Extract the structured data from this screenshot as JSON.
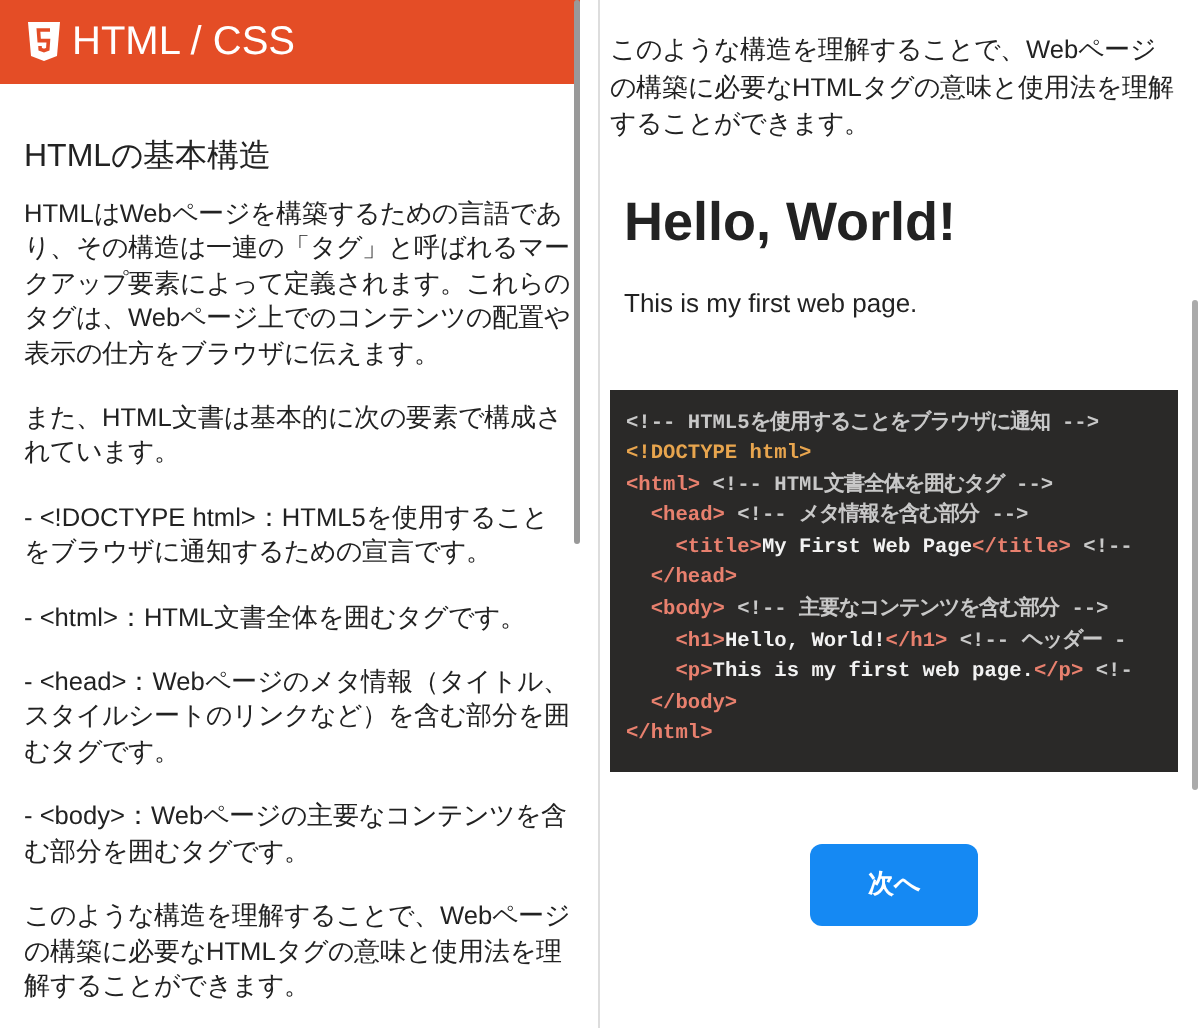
{
  "left": {
    "header": {
      "title": "HTML / CSS"
    },
    "heading": "HTMLの基本構造",
    "paragraphs": [
      "HTMLはWebページを構築するための言語であり、その構造は一連の「タグ」と呼ばれるマークアップ要素によって定義されます。これらのタグは、Webページ上でのコンテンツの配置や表示の仕方をブラウザに伝えます。",
      "また、HTML文書は基本的に次の要素で構成されています。",
      "- <!DOCTYPE html>：HTML5を使用することをブラウザに通知するための宣言です。",
      "- <html>：HTML文書全体を囲むタグです。",
      "- <head>：Webページのメタ情報（タイトル、スタイルシートのリンクなど）を含む部分を囲むタグです。",
      "- <body>：Webページの主要なコンテンツを含む部分を囲むタグです。",
      "このような構造を理解することで、Webページの構築に必要なHTMLタグの意味と使用法を理解することができます。"
    ]
  },
  "right": {
    "paragraph": "このような構造を理解することで、Webページの構築に必要なHTMLタグの意味と使用法を理解することができます。",
    "preview": {
      "heading": "Hello, World!",
      "text": "This is my first web page."
    },
    "code_lines": [
      {
        "segments": [
          {
            "kind": "comment",
            "text": "<!-- HTML5を使用することをブラウザに通知 -->"
          }
        ]
      },
      {
        "segments": [
          {
            "kind": "doctype",
            "text": "<!DOCTYPE html>"
          }
        ]
      },
      {
        "segments": [
          {
            "kind": "tag",
            "text": "<html>"
          },
          {
            "kind": "comment",
            "text": " <!-- HTML文書全体を囲むタグ -->"
          }
        ]
      },
      {
        "segments": [
          {
            "kind": "tag",
            "text": "  <head>"
          },
          {
            "kind": "comment",
            "text": " <!-- メタ情報を含む部分 -->"
          }
        ]
      },
      {
        "segments": [
          {
            "kind": "tag",
            "text": "    <title>"
          },
          {
            "kind": "text",
            "text": "My First Web Page"
          },
          {
            "kind": "tag",
            "text": "</title>"
          },
          {
            "kind": "comment",
            "text": " <!--"
          }
        ]
      },
      {
        "segments": [
          {
            "kind": "tag",
            "text": "  </head>"
          }
        ]
      },
      {
        "segments": [
          {
            "kind": "tag",
            "text": "  <body>"
          },
          {
            "kind": "comment",
            "text": " <!-- 主要なコンテンツを含む部分 -->"
          }
        ]
      },
      {
        "segments": [
          {
            "kind": "tag",
            "text": "    <h1>"
          },
          {
            "kind": "text",
            "text": "Hello, World!"
          },
          {
            "kind": "tag",
            "text": "</h1>"
          },
          {
            "kind": "comment",
            "text": " <!-- ヘッダー -"
          }
        ]
      },
      {
        "segments": [
          {
            "kind": "tag",
            "text": "    <p>"
          },
          {
            "kind": "text",
            "text": "This is my first web page."
          },
          {
            "kind": "tag",
            "text": "</p>"
          },
          {
            "kind": "comment",
            "text": " <!-"
          }
        ]
      },
      {
        "segments": [
          {
            "kind": "tag",
            "text": "  </body>"
          }
        ]
      },
      {
        "segments": [
          {
            "kind": "tag",
            "text": "</html>"
          }
        ]
      }
    ],
    "next_button": "次へ"
  }
}
